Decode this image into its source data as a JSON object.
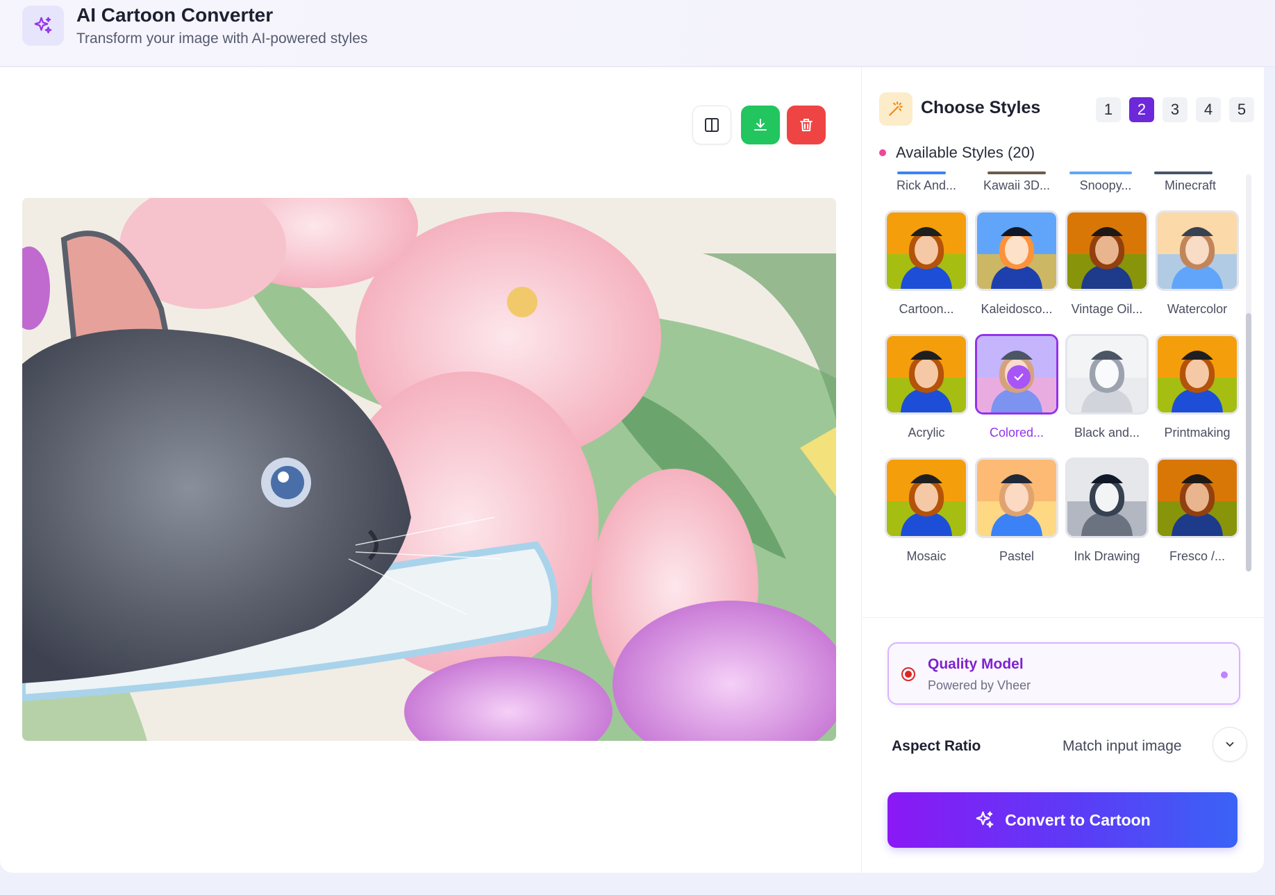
{
  "header": {
    "title": "AI Cartoon Converter",
    "subtitle": "Transform your image with AI-powered styles",
    "logo_icon": "sparkles-icon"
  },
  "toolbar": {
    "compare_icon": "split-view-icon",
    "download_icon": "download-icon",
    "delete_icon": "trash-icon"
  },
  "styles_panel": {
    "title": "Choose Styles",
    "icon": "magic-wand-icon",
    "pages": [
      "1",
      "2",
      "3",
      "4",
      "5"
    ],
    "active_page": "2",
    "available_label": "Available Styles (20)",
    "top_row": [
      "Rick And...",
      "Kawaii 3D...",
      "Snoopy...",
      "Minecraft"
    ],
    "tiles": [
      {
        "label": "Cartoon...",
        "tone": "vivid"
      },
      {
        "label": "Kaleidosco...",
        "tone": "anime"
      },
      {
        "label": "Vintage Oil...",
        "tone": "oil"
      },
      {
        "label": "Watercolor",
        "tone": "water"
      },
      {
        "label": "Acrylic",
        "tone": "vivid"
      },
      {
        "label": "Colored...",
        "tone": "pastel",
        "selected": true
      },
      {
        "label": "Black and...",
        "tone": "sketch"
      },
      {
        "label": "Printmaking",
        "tone": "vivid"
      },
      {
        "label": "Mosaic",
        "tone": "vivid"
      },
      {
        "label": "Pastel",
        "tone": "pastel2"
      },
      {
        "label": "Ink Drawing",
        "tone": "ink"
      },
      {
        "label": "Fresco /...",
        "tone": "oil"
      }
    ]
  },
  "model": {
    "title": "Quality Model",
    "subtitle": "Powered by Vheer"
  },
  "aspect": {
    "label": "Aspect Ratio",
    "value": "Match input image"
  },
  "convert": {
    "label": "Convert to Cartoon"
  },
  "colors": {
    "accent": "#6d28d9",
    "download": "#22c55e",
    "delete": "#ef4444",
    "selected_border": "#9333ea"
  }
}
